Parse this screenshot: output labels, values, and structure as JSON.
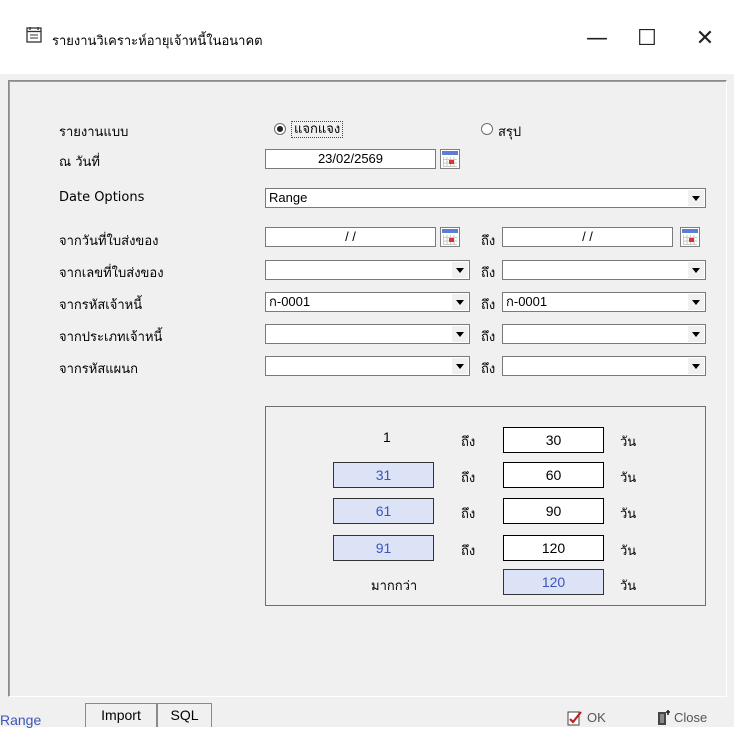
{
  "window": {
    "title": "รายงานวิเคราะห์อายุเจ้าหนี้ในอนาคต",
    "minimize_symbol": "—",
    "maximize_symbol": "☐",
    "close_symbol": "✕"
  },
  "form": {
    "report_type_label": "รายงานแบบ",
    "report_type_options": [
      "แจกแจง",
      "สรุป"
    ],
    "report_type_selected": "แจกแจง",
    "as_of_label": "ณ วันที่",
    "as_of_value": "23/02/2569",
    "date_options_label": "Date Options",
    "date_options_value": "Range",
    "delivery_date_label": "จากวันที่ใบส่งของ",
    "delivery_date_from": "/ /",
    "delivery_date_to": "/ /",
    "delivery_no_label": "จากเลขที่ใบส่งของ",
    "delivery_no_from": "",
    "delivery_no_to": "",
    "creditor_code_label": "จากรหัสเจ้าหนี้",
    "creditor_code_from": "ก-0001",
    "creditor_code_to": "ก-0001",
    "creditor_type_label": "จากประเภทเจ้าหนี้",
    "creditor_type_from": "",
    "creditor_type_to": "",
    "department_label": "จากรหัสแผนก",
    "department_from": "",
    "department_to": "",
    "to_label": "ถึง"
  },
  "aging": {
    "rows": [
      {
        "from": "1",
        "to": "30"
      },
      {
        "from": "31",
        "to": "60"
      },
      {
        "from": "61",
        "to": "90"
      },
      {
        "from": "91",
        "to": "120"
      }
    ],
    "to_label": "ถึง",
    "day_label": "วัน",
    "more_than_label": "มากกว่า",
    "more_than_value": "120"
  },
  "tabs": [
    "Range",
    "Import",
    "SQL"
  ],
  "buttons": {
    "ok": "OK",
    "close": "Close"
  },
  "colors": {
    "accent_blue": "#3c56b8",
    "field_blue": "#dde3f6"
  }
}
